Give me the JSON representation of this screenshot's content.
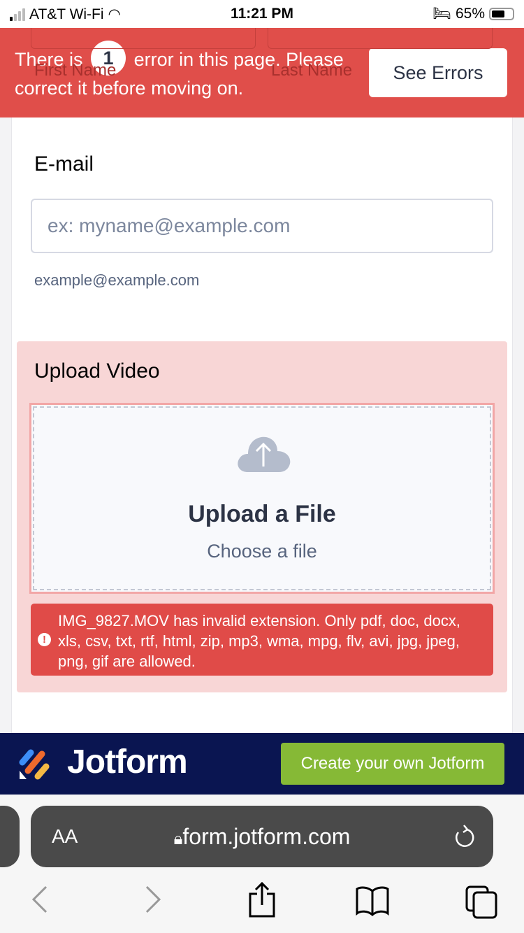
{
  "status_bar": {
    "carrier": "AT&T Wi-Fi",
    "time": "11:21 PM",
    "battery": "65%"
  },
  "background_fields": {
    "first_name": "First Name",
    "last_name": "Last Name"
  },
  "error_banner": {
    "text_before": "There is",
    "count": "1",
    "text_after": "error in this page. Please correct it before moving on.",
    "see_errors": "See Errors",
    "color": "#e04e4a"
  },
  "email": {
    "label": "E-mail",
    "placeholder": "ex: myname@example.com",
    "value": "",
    "sublabel": "example@example.com"
  },
  "upload": {
    "label": "Upload Video",
    "title": "Upload a File",
    "subtitle": "Choose a file",
    "error": "IMG_9827.MOV has invalid extension. Only pdf, doc, docx, xls, csv, txt, rtf, html, zip, mp3, wma, mpg, flv, avi, jpg, jpeg, png, gif are allowed.",
    "error_color": "#e04b48"
  },
  "footer": {
    "brand": "Jotform",
    "cta": "Create your own Jotform",
    "brand_color": "#0a1551",
    "cta_color": "#86b936"
  },
  "browser": {
    "text_size": "AA",
    "url": "form.jotform.com"
  }
}
